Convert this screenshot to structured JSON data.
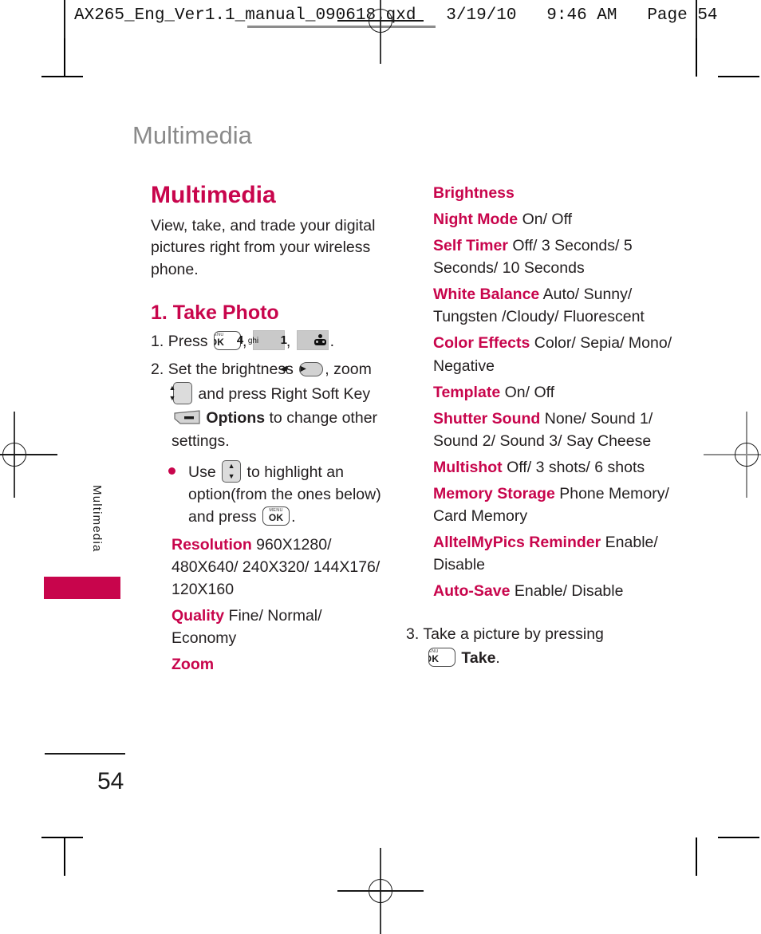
{
  "print_header": {
    "text": "AX265_Eng_Ver1.1_manual_090618.qxd   3/19/10   9:46 AM   Page 54"
  },
  "running_head": "Multimedia",
  "side_tab": {
    "label": "Multimedia",
    "accent_color": "#c8054c"
  },
  "footer": {
    "page_number": "54"
  },
  "colors": {
    "accent": "#c8054c",
    "body_text": "#231f20",
    "running_head": "#8a8a8a"
  },
  "left_column": {
    "section_title": "Multimedia",
    "intro": "View, take, and trade your digital pictures right from your wireless phone.",
    "subsection_title": "1. Take Photo",
    "step1": {
      "number": "1.",
      "press_label": "Press",
      "keys": [
        {
          "name": "menu-ok-key",
          "top": "MENU",
          "main": "OK"
        },
        {
          "name": "digit-4-key",
          "digit": "4",
          "sub": "ghi"
        },
        {
          "name": "digit-1-key",
          "digit": "1",
          "sub": "voicemail"
        }
      ],
      "period": "."
    },
    "step2": {
      "number": "2.",
      "part1": "Set the brightness",
      "part2": ", zoom",
      "part3": "and press Right Soft Key",
      "options_label": "Options",
      "part4": "to change other settings."
    },
    "bullet": {
      "part1": "Use",
      "part2": "to highlight an option(from the ones below) and press",
      "period": "."
    },
    "options": [
      {
        "label": "Resolution",
        "values": "960X1280/ 480X640/ 240X320/ 144X176/ 120X160"
      },
      {
        "label": "Quality",
        "values": "Fine/ Normal/ Economy"
      },
      {
        "label": "Zoom",
        "values": ""
      }
    ]
  },
  "right_column": {
    "options": [
      {
        "label": "Brightness",
        "values": ""
      },
      {
        "label": "Night Mode",
        "values": "On/ Off"
      },
      {
        "label": "Self Timer",
        "values": "Off/ 3 Seconds/ 5 Seconds/ 10 Seconds"
      },
      {
        "label": "White Balance",
        "values": "Auto/ Sunny/ Tungsten /Cloudy/ Fluorescent"
      },
      {
        "label": "Color Effects",
        "values": "Color/ Sepia/ Mono/ Negative"
      },
      {
        "label": "Template",
        "values": "On/ Off"
      },
      {
        "label": "Shutter Sound",
        "values": "None/ Sound 1/ Sound 2/ Sound 3/ Say Cheese"
      },
      {
        "label": "Multishot",
        "values": "Off/ 3 shots/ 6 shots"
      },
      {
        "label": "Memory Storage",
        "values": "Phone Memory/ Card Memory"
      },
      {
        "label": "AlltelMyPics Reminder",
        "values": "Enable/ Disable"
      },
      {
        "label": "Auto-Save",
        "values": "Enable/ Disable"
      }
    ],
    "step3": {
      "number": "3.",
      "part1": "Take a picture by pressing",
      "take_label": "Take",
      "period": "."
    }
  }
}
